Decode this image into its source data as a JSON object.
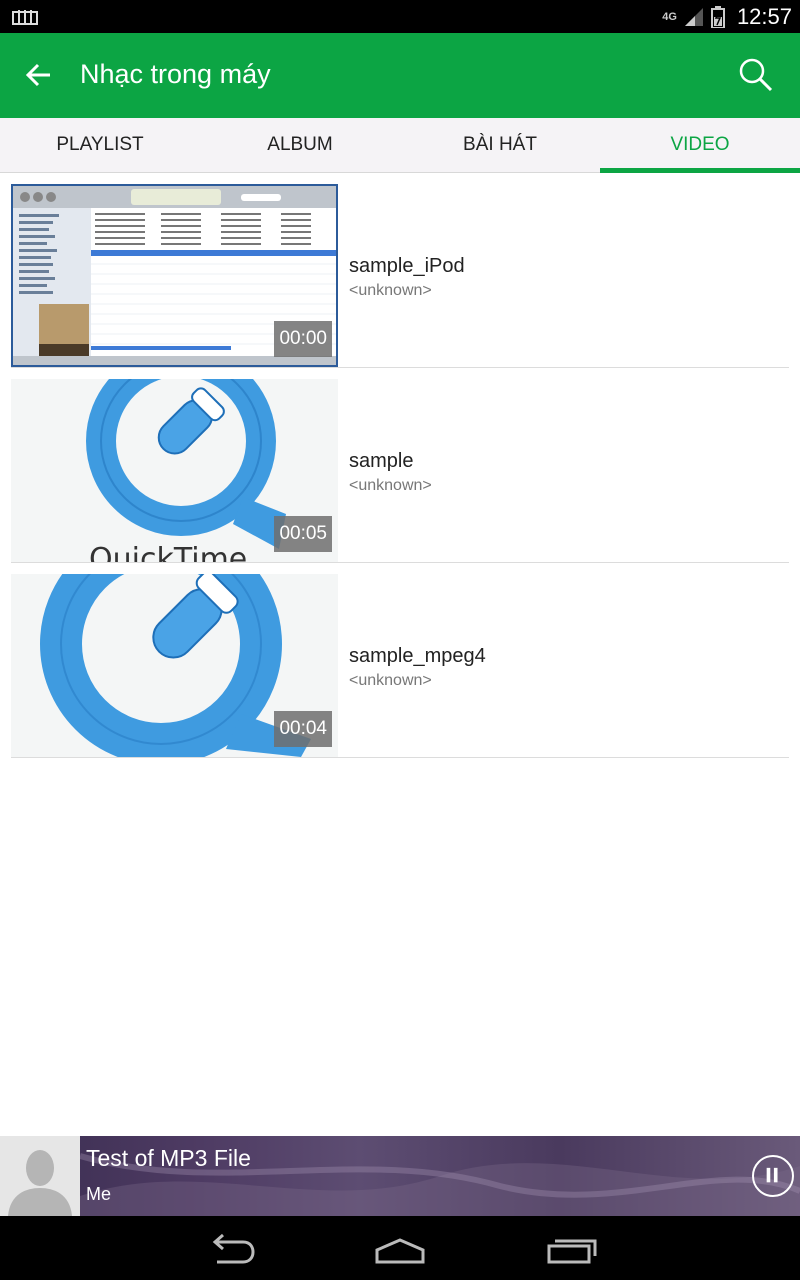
{
  "status_bar": {
    "network": "4G",
    "time": "12:57"
  },
  "app_bar": {
    "title": "Nhạc trong máy",
    "back_icon": "arrow-left-icon",
    "search_icon": "search-icon",
    "color": "#0ca544"
  },
  "tabs": [
    {
      "label": "PLAYLIST",
      "active": false
    },
    {
      "label": "ALBUM",
      "active": false
    },
    {
      "label": "BÀI HÁT",
      "active": false
    },
    {
      "label": "VIDEO",
      "active": true
    }
  ],
  "videos": [
    {
      "title": "sample_iPod",
      "artist": "<unknown>",
      "duration": "00:00",
      "thumbnail": "itunes-window-thumbnail"
    },
    {
      "title": "sample",
      "artist": "<unknown>",
      "duration": "00:05",
      "thumbnail": "quicktime-logo-thumbnail"
    },
    {
      "title": "sample_mpeg4",
      "artist": "<unknown>",
      "duration": "00:04",
      "thumbnail": "quicktime-logo-thumbnail"
    }
  ],
  "mini_player": {
    "song": "Test of MP3 File",
    "artist": "Me",
    "avatar_icon": "person-silhouette-icon",
    "control_icon": "pause-icon"
  },
  "nav_bar": {
    "back_icon": "back-icon",
    "home_icon": "home-icon",
    "recents_icon": "recents-icon"
  }
}
